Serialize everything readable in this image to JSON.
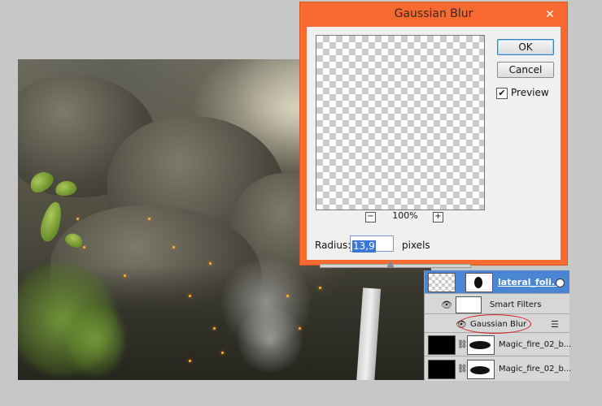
{
  "dialog": {
    "title": "Gaussian Blur",
    "close_icon": "close-icon",
    "ok_label": "OK",
    "cancel_label": "Cancel",
    "preview_label": "Preview",
    "preview_checked": true,
    "preview_check_glyph": "✔",
    "zoom_out_label": "−",
    "zoom_in_label": "+",
    "zoom_level": "100%",
    "radius_label": "Radius:",
    "radius_value": "13,9",
    "radius_unit": "pixels"
  },
  "layers": {
    "rows": [
      {
        "name": "lateral_foli...",
        "selected": true,
        "smart_object": true
      },
      {
        "name": "Smart Filters"
      },
      {
        "name": "Gaussian Blur",
        "highlighted": true
      },
      {
        "name": "Magic_fire_02_b..."
      },
      {
        "name": "Magic_fire_02_b..."
      }
    ]
  },
  "colors": {
    "dialog_frame": "#f86a2f",
    "selected_layer": "#4a86d4",
    "highlight_ellipse": "#d62020"
  }
}
